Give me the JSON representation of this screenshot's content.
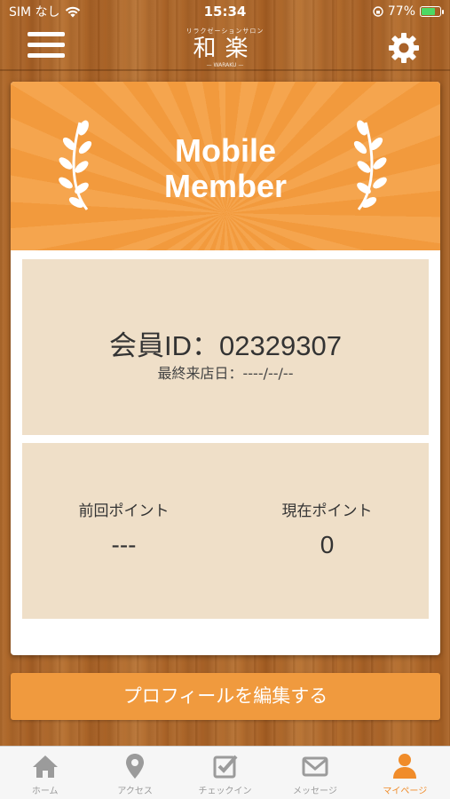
{
  "status_bar": {
    "carrier": "SIM なし",
    "time": "15:34",
    "battery_percent": "77%",
    "battery_level": 0.77
  },
  "header": {
    "logo_sub": "リラクゼーションサロン",
    "logo_main": "和楽",
    "logo_foot": "— WARAKU —"
  },
  "banner": {
    "title_line1": "Mobile",
    "title_line2": "Member"
  },
  "member": {
    "id_text": "会員ID：02329307",
    "last_visit": "最終来店日：----/--/--"
  },
  "points": {
    "previous_label": "前回ポイント",
    "previous_value": "---",
    "current_label": "現在ポイント",
    "current_value": "0"
  },
  "edit_profile_label": "プロフィールを編集する",
  "tabs": [
    {
      "label": "ホーム",
      "icon": "home-icon"
    },
    {
      "label": "アクセス",
      "icon": "map-pin-icon"
    },
    {
      "label": "チェックイン",
      "icon": "checkin-icon"
    },
    {
      "label": "メッセージ",
      "icon": "mail-icon"
    },
    {
      "label": "マイページ",
      "icon": "person-icon",
      "active": true
    }
  ],
  "colors": {
    "accent": "#f09a3e",
    "panel": "#efdfc8",
    "tab_active": "#f08c2a"
  }
}
